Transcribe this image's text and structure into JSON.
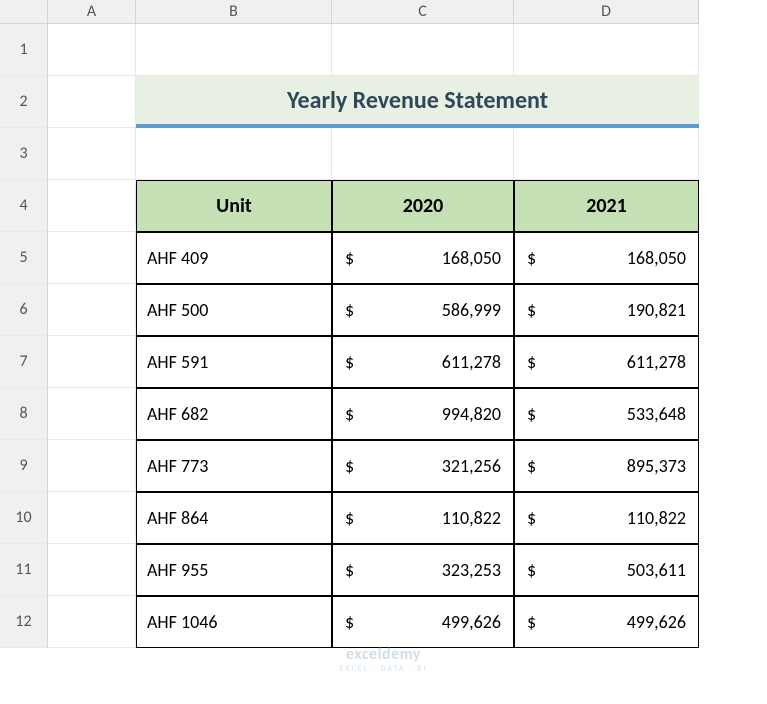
{
  "columns": [
    "A",
    "B",
    "C",
    "D"
  ],
  "rows": [
    "1",
    "2",
    "3",
    "4",
    "5",
    "6",
    "7",
    "8",
    "9",
    "10",
    "11",
    "12"
  ],
  "title": "Yearly Revenue Statement",
  "headers": {
    "unit": "Unit",
    "y2020": "2020",
    "y2021": "2021"
  },
  "currency": "$",
  "data": [
    {
      "unit": "AHF 409",
      "y2020": "168,050",
      "y2021": "168,050"
    },
    {
      "unit": "AHF 500",
      "y2020": "586,999",
      "y2021": "190,821"
    },
    {
      "unit": "AHF 591",
      "y2020": "611,278",
      "y2021": "611,278"
    },
    {
      "unit": "AHF 682",
      "y2020": "994,820",
      "y2021": "533,648"
    },
    {
      "unit": "AHF 773",
      "y2020": "321,256",
      "y2021": "895,373"
    },
    {
      "unit": "AHF 864",
      "y2020": "110,822",
      "y2021": "110,822"
    },
    {
      "unit": "AHF 955",
      "y2020": "323,253",
      "y2021": "503,611"
    },
    {
      "unit": "AHF 1046",
      "y2020": "499,626",
      "y2021": "499,626"
    }
  ],
  "watermark": {
    "top": "exceldemy",
    "sub": "EXCEL · DATA · BI"
  },
  "chart_data": {
    "type": "table",
    "title": "Yearly Revenue Statement",
    "columns": [
      "Unit",
      "2020",
      "2021"
    ],
    "rows": [
      [
        "AHF 409",
        168050,
        168050
      ],
      [
        "AHF 500",
        586999,
        190821
      ],
      [
        "AHF 591",
        611278,
        611278
      ],
      [
        "AHF 682",
        994820,
        533648
      ],
      [
        "AHF 773",
        321256,
        895373
      ],
      [
        "AHF 864",
        110822,
        110822
      ],
      [
        "AHF 955",
        323253,
        503611
      ],
      [
        "AHF 1046",
        499626,
        499626
      ]
    ]
  }
}
